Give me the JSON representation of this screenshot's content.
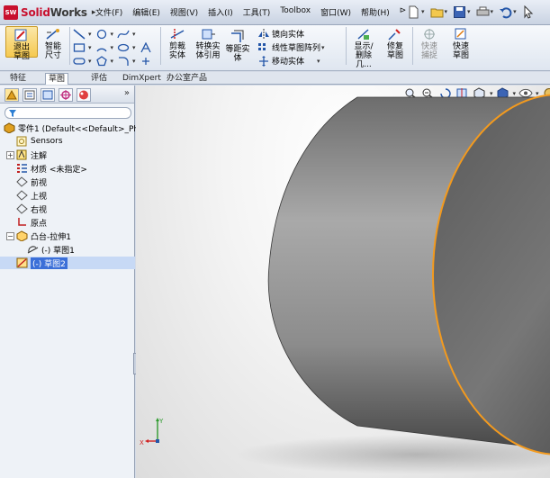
{
  "app": {
    "name_prefix": "Solid",
    "name_suffix": "Works",
    "logo_mark": "SW",
    "logo_arrow": "▸"
  },
  "menu": [
    "文件(F)",
    "编辑(E)",
    "视图(V)",
    "插入(I)",
    "工具(T)",
    "Toolbox",
    "窗口(W)",
    "帮助(H)",
    "⊳"
  ],
  "quick_access": [
    "new-icon",
    "open-icon",
    "save-icon",
    "print-icon",
    "undo-icon",
    "select-icon"
  ],
  "ribbon": {
    "exit_sketch": "退出草图",
    "smart_dimension": "智能尺寸",
    "trim_entities": "剪裁实体",
    "convert_entities": "转换实体引用",
    "offset_entities": "等距实体",
    "mirror_entities": "镜向实体",
    "linear_pattern": "线性草图阵列",
    "move_entities": "移动实体",
    "display_delete": "显示/删除几...",
    "repair_sketch": "修复草图",
    "quick_snaps": "快速捕捉",
    "rapid_sketch": "快速草图"
  },
  "tabs": [
    "特征",
    "草图",
    "评估",
    "DimXpert",
    "办公室产品"
  ],
  "active_tab": 1,
  "panel": {
    "expand": "»"
  },
  "tree": [
    {
      "label": "零件1  (Default<<Default>_Ph",
      "icon": "part-icon"
    },
    {
      "label": "Sensors",
      "icon": "sensor-icon"
    },
    {
      "label": "注解",
      "icon": "annotation-icon"
    },
    {
      "label": "材质 <未指定>",
      "icon": "material-icon"
    },
    {
      "label": "前视",
      "icon": "plane-icon"
    },
    {
      "label": "上视",
      "icon": "plane-icon"
    },
    {
      "label": "右视",
      "icon": "plane-icon"
    },
    {
      "label": "原点",
      "icon": "origin-icon"
    },
    {
      "label": "凸台-拉伸1",
      "icon": "extrude-icon"
    },
    {
      "label": "(-) 草图1",
      "icon": "sketch-icon"
    },
    {
      "label": "(-) 草图2",
      "icon": "sketch-icon"
    }
  ],
  "triad": {
    "x": "X",
    "y": "Y"
  },
  "colors": {
    "accent": "#f39a1e",
    "selection": "#3b6fd8",
    "brand": "#c8102e"
  }
}
